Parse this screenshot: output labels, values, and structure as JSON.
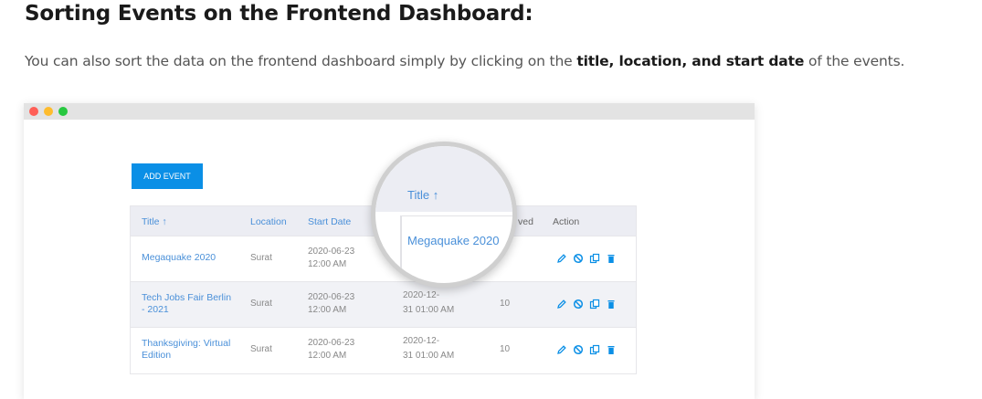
{
  "heading": "Sorting Events on the Frontend Dashboard:",
  "intro": {
    "prefix": "You can also sort the data on the frontend dashboard simply by clicking on the ",
    "bold": "title, location, and start date",
    "suffix": " of the events."
  },
  "colors": {
    "accent": "#0a8fe6",
    "link": "#4a90d9",
    "header_bg": "#ecedf3",
    "dot_red": "#ff5f57",
    "dot_yellow": "#febc2e",
    "dot_green": "#28c840"
  },
  "dashboard": {
    "add_button": "ADD EVENT",
    "columns": {
      "title": "Title ↑",
      "location": "Location",
      "start_date": "Start Date",
      "approved_partial": "ved",
      "action": "Action"
    },
    "rows": [
      {
        "title": "Megaquake 2020",
        "location": "Surat",
        "start_date": "2020-06-23",
        "start_time": "12:00 AM",
        "end_date": "",
        "end_time": "",
        "count": ""
      },
      {
        "title": "Tech Jobs Fair Berlin - 2021",
        "location": "Surat",
        "start_date": "2020-06-23",
        "start_time": "12:00 AM",
        "end_date": "2020-12-",
        "end_time": "31 01:00 AM",
        "count": "10"
      },
      {
        "title": "Thanksgiving: Virtual Edition",
        "location": "Surat",
        "start_date": "2020-06-23",
        "start_time": "12:00 AM",
        "end_date": "2020-12-",
        "end_time": "31 01:00 AM",
        "count": "10"
      }
    ],
    "action_icons": [
      "pencil-icon",
      "ban-icon",
      "copy-icon",
      "trash-icon"
    ],
    "magnifier": {
      "header": "Title ↑",
      "cell": "Megaquake 2020"
    }
  }
}
